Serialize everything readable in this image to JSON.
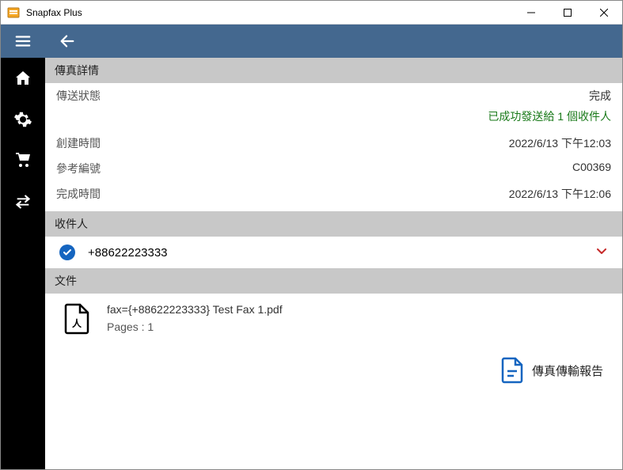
{
  "window": {
    "title": "Snapfax Plus"
  },
  "sections": {
    "fax_details": "傳真詳情",
    "recipients": "收件人",
    "documents": "文件"
  },
  "details": {
    "status_label": "傳送狀態",
    "status_value": "完成",
    "success_msg": "已成功發送給 1 個收件人",
    "created_label": "創建時間",
    "created_value": "2022/6/13 下午12:03",
    "ref_label": "參考編號",
    "ref_value": "C00369",
    "completed_label": "完成時間",
    "completed_value": "2022/6/13 下午12:06"
  },
  "recipient": {
    "number": "+88622223333"
  },
  "file": {
    "name": "fax={+88622223333} Test Fax 1.pdf",
    "pages_label": "Pages :  1"
  },
  "report": {
    "label": "傳真傳輸報告"
  }
}
